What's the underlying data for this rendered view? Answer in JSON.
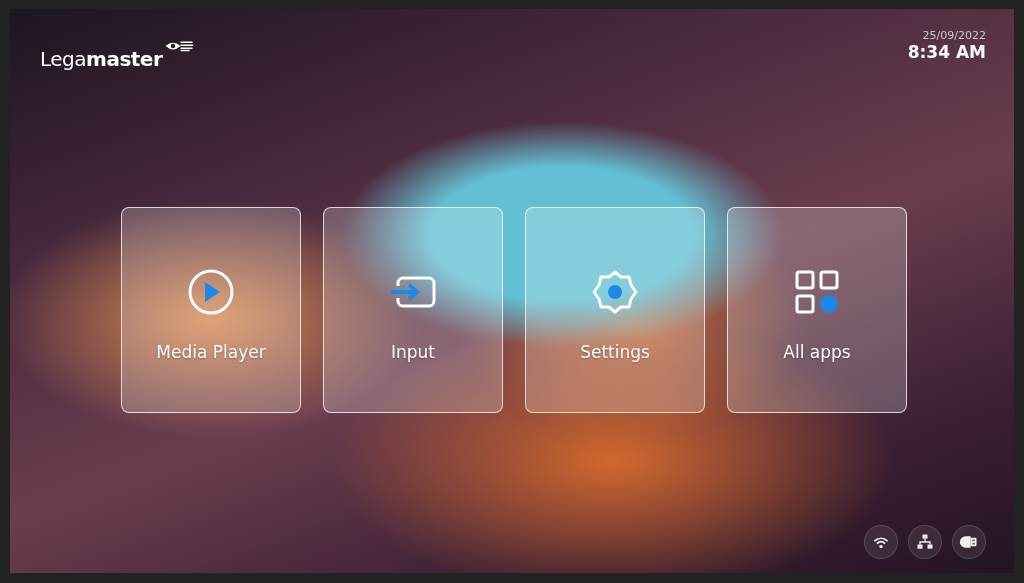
{
  "header": {
    "logo": "Lega**master**",
    "date": "25/09/2022",
    "time": "8:34 AM"
  },
  "tiles": [
    {
      "kind": "play",
      "label": "Media Player"
    },
    {
      "kind": "input",
      "label": "Input"
    },
    {
      "kind": "settings",
      "label": "Settings"
    },
    {
      "kind": "apps",
      "label": "All apps"
    }
  ],
  "status_icons": [
    {
      "kind": "wifi"
    },
    {
      "kind": "network"
    },
    {
      "kind": "usb"
    }
  ]
}
